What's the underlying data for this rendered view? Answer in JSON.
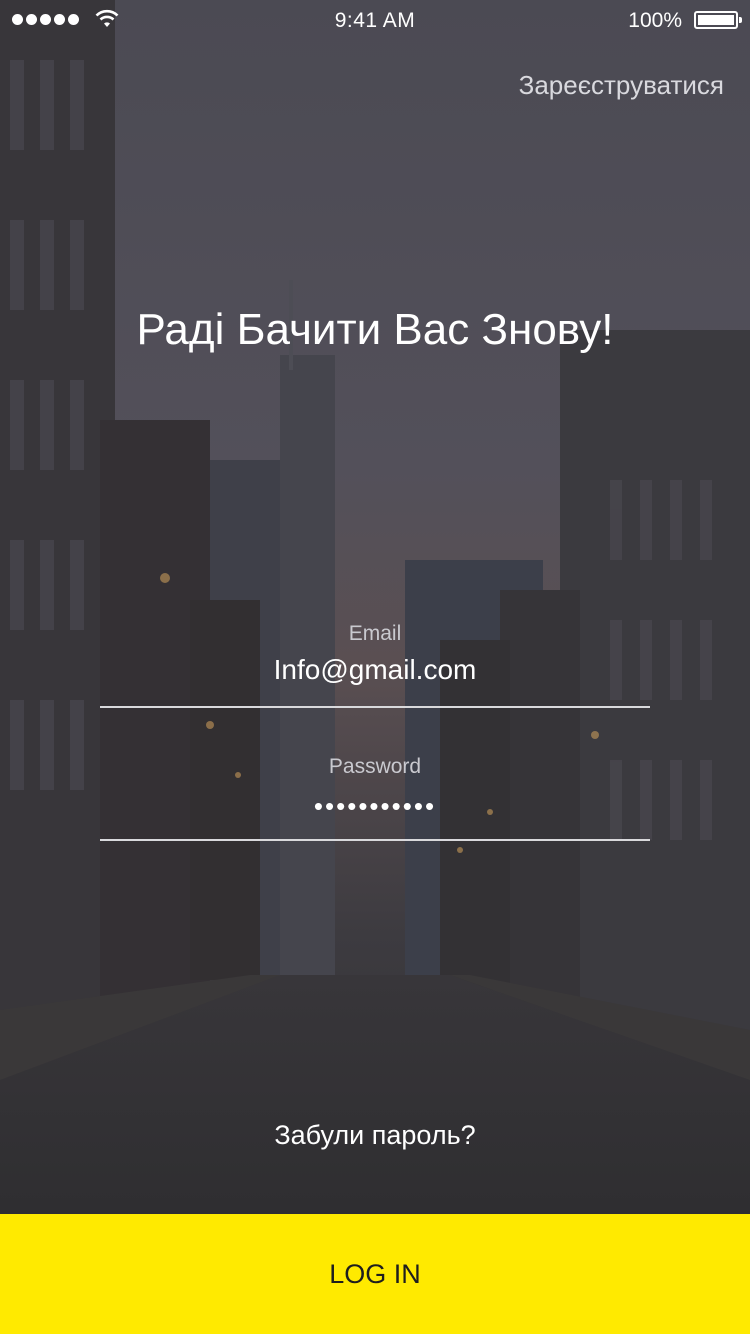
{
  "colors": {
    "accent": "#FFEA00",
    "overlay": "#2f2f36"
  },
  "status_bar": {
    "time": "9:41 AM",
    "battery": "100%",
    "wifi_icon": "wifi-icon",
    "signal_icon": "signal-dots-icon"
  },
  "header": {
    "register_link": "Зареєструватися"
  },
  "hero": {
    "title": "Раді Бачити Вас Знову!"
  },
  "form": {
    "email": {
      "label": "Email",
      "value": "Info@gmail.com"
    },
    "password": {
      "label": "Password",
      "value": "•••••••••••"
    }
  },
  "forgot_link": "Забули пароль?",
  "login_button": "LOG IN"
}
